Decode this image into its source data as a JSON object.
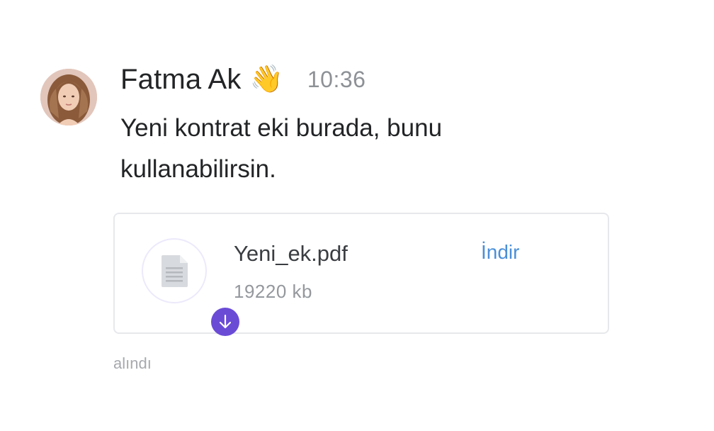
{
  "message": {
    "sender_name": "Fatma Ak",
    "sender_emoji": "👋",
    "time": "10:36",
    "text": "Yeni kontrat eki burada, bunu kullanabilirsin.",
    "attachment": {
      "file_name": "Yeni_ek.pdf",
      "file_size": "19220 kb",
      "download_label": "İndir",
      "icon": "document-icon",
      "badge_icon": "arrow-down-icon",
      "accent_color": "#6a4bd6",
      "link_color": "#4a8fd8"
    },
    "status": "alındı"
  }
}
